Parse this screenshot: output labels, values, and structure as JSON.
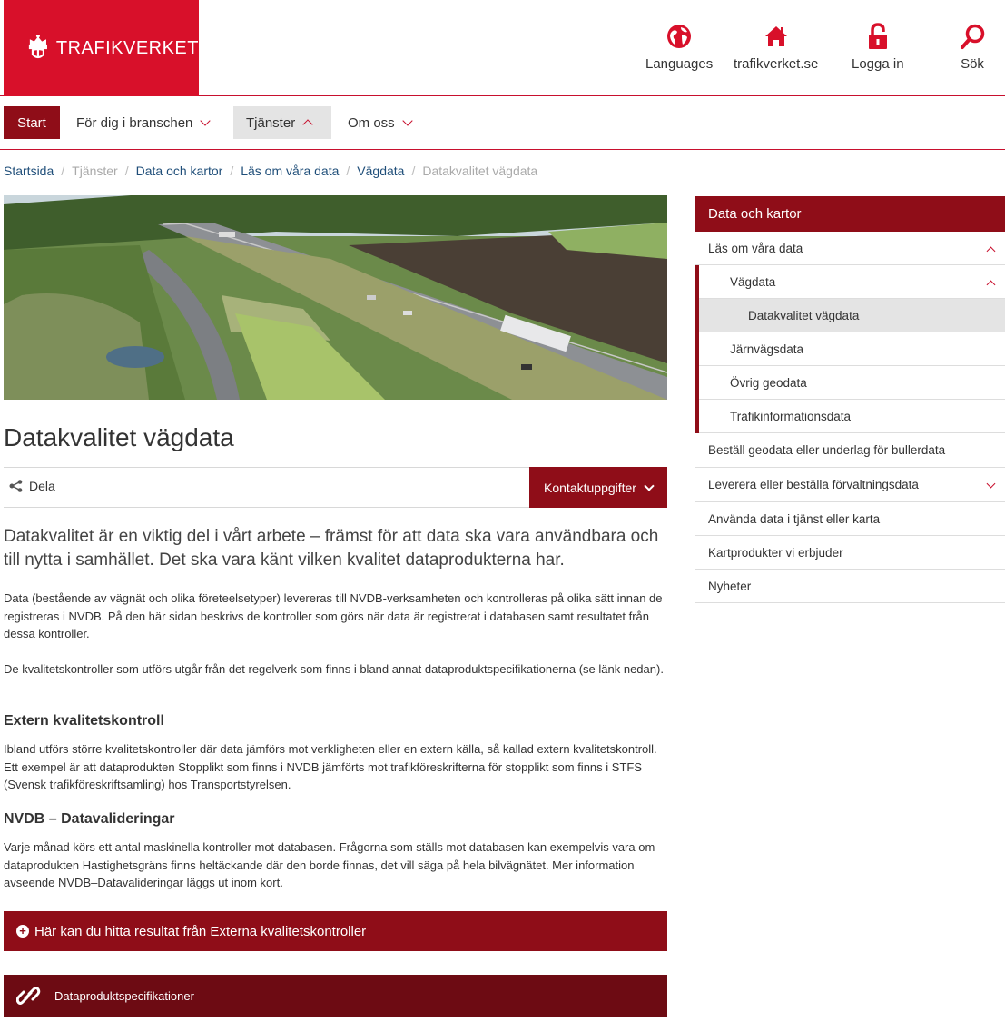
{
  "header": {
    "logo_text": "TRAFIKVERKET",
    "utility": [
      {
        "label": "Languages",
        "icon": "globe-icon"
      },
      {
        "label": "trafikverket.se",
        "icon": "home-icon"
      },
      {
        "label": "Logga in",
        "icon": "lock-icon"
      },
      {
        "label": "Sök",
        "icon": "search-icon"
      }
    ],
    "brand_color": "#d8102a"
  },
  "nav": {
    "start": "Start",
    "items": [
      {
        "label": "För dig i branschen"
      },
      {
        "label": "Tjänster"
      },
      {
        "label": "Om oss"
      }
    ]
  },
  "breadcrumb": [
    "Startsida",
    "Tjänster",
    "Data och kartor",
    "Läs om våra data",
    "Vägdata",
    "Datakvalitet vägdata"
  ],
  "main": {
    "title": "Datakvalitet vägdata",
    "share": "Dela",
    "contact": "Kontaktuppgifter",
    "lead": "Datakvalitet är en viktig del i vårt arbete – främst för att data ska vara användbara och till nytta i samhället. Det ska vara känt vilken kvalitet dataprodukterna har.",
    "p1": "Data (bestående av vägnät och olika företeelsetyper) levereras till NVDB-verksamheten  och kontrolleras på olika sätt innan de registreras i NVDB. På den här sidan beskrivs de kontroller som görs när data är registrerat i databasen samt resultatet från dessa kontroller.",
    "p2": "De kvalitetskontroller som utförs utgår från det regelverk som finns i bland annat dataproduktspecifikationerna (se länk nedan).",
    "h1": "Extern kvalitetskontroll",
    "p3": "Ibland utförs större kvalitetskontroller där data jämförs mot verkligheten eller en extern källa, så kallad extern kvalitetskontroll. Ett exempel är att dataprodukten Stopplikt som finns i NVDB jämförts mot trafikföreskrifterna för stopplikt som finns i STFS (Svensk trafikföreskriftsamling) hos Transportstyrelsen.",
    "h2": "NVDB – Datavalideringar",
    "p4": "Varje månad körs ett antal maskinella kontroller mot databasen. Frågorna som ställs mot databasen kan exempelvis vara om dataprodukten Hastighetsgräns finns heltäckande där den borde finnas, det vill säga på hela bilvägnätet. Mer information avseende NVDB–Datavalideringar läggs ut inom kort.",
    "accordion": "Här kan du hitta resultat från Externa kvalitetskontroller",
    "link": "Dataproduktspecifikationer"
  },
  "sidebar": {
    "heading": "Data och kartor",
    "items": [
      {
        "label": "Läs om våra data"
      },
      {
        "label": "Vägdata"
      },
      {
        "label": "Datakvalitet vägdata"
      },
      {
        "label": "Järnvägsdata"
      },
      {
        "label": "Övrig geodata"
      },
      {
        "label": "Trafikinformationsdata"
      },
      {
        "label": "Beställ geodata eller underlag för bullerdata"
      },
      {
        "label": "Leverera eller beställa förvaltningsdata"
      },
      {
        "label": "Använda data i tjänst eller karta"
      },
      {
        "label": "Kartprodukter vi erbjuder"
      },
      {
        "label": "Nyheter"
      }
    ]
  }
}
